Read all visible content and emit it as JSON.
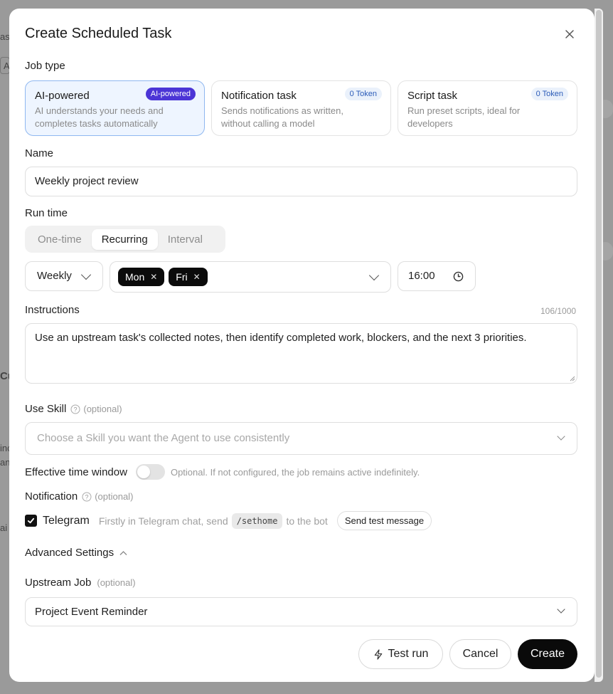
{
  "modal": {
    "title": "Create Scheduled Task"
  },
  "job_type": {
    "label": "Job type",
    "cards": [
      {
        "title": "AI-powered",
        "badge": "AI-powered",
        "desc": "AI understands your needs and completes tasks automatically",
        "selected": true
      },
      {
        "title": "Notification task",
        "badge": "0 Token",
        "desc": "Sends notifications as written, without calling a model",
        "selected": false
      },
      {
        "title": "Script task",
        "badge": "0 Token",
        "desc": "Run preset scripts, ideal for developers",
        "selected": false
      }
    ]
  },
  "name": {
    "label": "Name",
    "value": "Weekly project review"
  },
  "run_time": {
    "label": "Run time",
    "modes": [
      "One-time",
      "Recurring",
      "Interval"
    ],
    "active_mode": "Recurring",
    "frequency": "Weekly",
    "days": [
      "Mon",
      "Fri"
    ],
    "time": "16:00"
  },
  "instructions": {
    "label": "Instructions",
    "counter": "106/1000",
    "value": "Use an upstream task's collected notes, then identify completed work, blockers, and the next 3 priorities."
  },
  "skill": {
    "label": "Use Skill",
    "optional": "(optional)",
    "placeholder": "Choose a Skill you want the Agent to use consistently"
  },
  "window": {
    "label": "Effective time window",
    "enabled": false,
    "hint": "Optional. If not configured, the job remains active indefinitely."
  },
  "notification": {
    "label": "Notification",
    "optional": "(optional)",
    "channel": "Telegram",
    "checked": true,
    "hint_before": "Firstly in Telegram chat, send",
    "command": "/sethome",
    "hint_after": "to the bot",
    "test_button": "Send test message"
  },
  "advanced": {
    "label": "Advanced Settings",
    "expanded": true
  },
  "upstream": {
    "label": "Upstream Job",
    "optional": "(optional)",
    "value": "Project Event Reminder"
  },
  "footer": {
    "test_run": "Test run",
    "cancel": "Cancel",
    "create": "Create"
  },
  "colors": {
    "primary": "#0a0a0a",
    "selected_card_border": "#8fb7f0",
    "selected_card_bg": "#eef5ff",
    "ai_badge": "#4b35d6",
    "token_badge_bg": "#eaf1fb"
  },
  "background_fragments": [
    "as",
    "A",
    "Cu",
    "inc",
    "and",
    "ai"
  ]
}
